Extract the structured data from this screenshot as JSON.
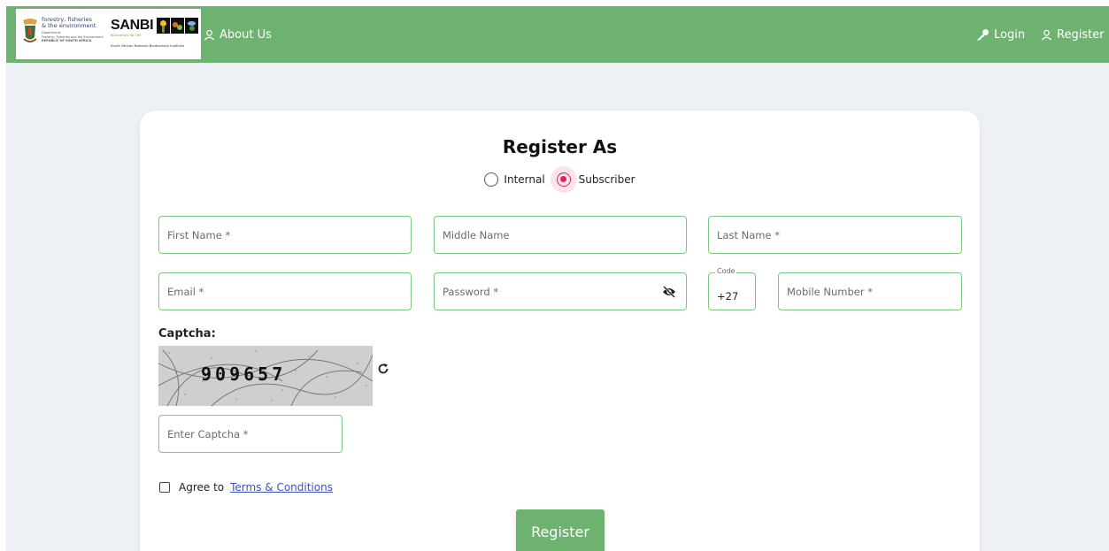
{
  "colors": {
    "brand_green": "#6db36f",
    "field_border": "#81c784",
    "radio_accent": "#e91e63",
    "link": "#3f51b5",
    "page_bg": "#edf0f4"
  },
  "header": {
    "logo_dffe": {
      "line1": "forestry, fisheries",
      "line2": "& the environment",
      "small1": "Department:",
      "small2": "Forestry, Fisheries and the Environment",
      "small3": "REPUBLIC OF SOUTH AFRICA"
    },
    "logo_sanbi": {
      "name": "SANBI",
      "tagline": "Biodiversity for Life",
      "full_name": "South African National Biodiversity Institute"
    },
    "nav": {
      "about": "About Us",
      "login": "Login",
      "register": "Register"
    }
  },
  "form": {
    "title": "Register As",
    "role_options": {
      "internal": "Internal",
      "subscriber": "Subscriber"
    },
    "selected_role": "Subscriber",
    "fields": {
      "first_name": "First Name *",
      "middle_name": "Middle Name",
      "last_name": "Last Name *",
      "email": "Email *",
      "password": "Password *",
      "code_label": "Code",
      "code_value": "+27",
      "mobile": "Mobile Number *"
    },
    "captcha": {
      "label": "Captcha:",
      "text": "909657",
      "input_placeholder": "Enter Captcha *"
    },
    "terms": {
      "agree": "Agree to",
      "link": "Terms & Conditions"
    },
    "submit": "Register"
  }
}
